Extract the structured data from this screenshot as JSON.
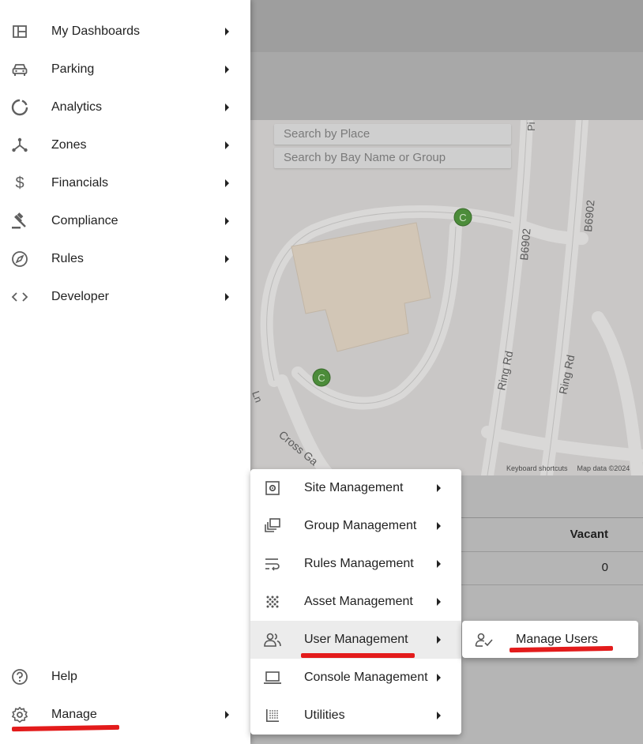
{
  "nav": {
    "items": [
      {
        "label": "My Dashboards",
        "icon": "dashboard-icon"
      },
      {
        "label": "Parking",
        "icon": "car-icon"
      },
      {
        "label": "Analytics",
        "icon": "donut-icon"
      },
      {
        "label": "Zones",
        "icon": "hub-icon"
      },
      {
        "label": "Financials",
        "icon": "dollar-icon"
      },
      {
        "label": "Compliance",
        "icon": "gavel-icon"
      },
      {
        "label": "Rules",
        "icon": "compass-icon"
      },
      {
        "label": "Developer",
        "icon": "code-icon"
      }
    ],
    "help_label": "Help",
    "manage_label": "Manage"
  },
  "manage_menu": {
    "items": [
      {
        "label": "Site Management",
        "icon": "settings-box-icon"
      },
      {
        "label": "Group Management",
        "icon": "library-icon"
      },
      {
        "label": "Rules Management",
        "icon": "wrap-text-icon"
      },
      {
        "label": "Asset Management",
        "icon": "dots-grid-icon"
      },
      {
        "label": "User Management",
        "icon": "people-icon"
      },
      {
        "label": "Console Management",
        "icon": "laptop-icon"
      },
      {
        "label": "Utilities",
        "icon": "grid-dots-icon"
      }
    ]
  },
  "user_menu": {
    "items": [
      {
        "label": "Manage Users",
        "icon": "person-check-icon"
      }
    ]
  },
  "map": {
    "search_place_placeholder": "Search by Place",
    "search_bay_placeholder": "Search by Bay Name or Group",
    "footer_shortcuts": "Keyboard shortcuts",
    "footer_data": "Map data ©2024",
    "road_labels": [
      "B6902",
      "B6902",
      "Ring Rd",
      "Ring Rd",
      "Cross Ga",
      "Ln",
      "Pi"
    ],
    "marker_letter": "C"
  },
  "table": {
    "header_vacant": "Vacant",
    "row_vacant_value": "0"
  },
  "colors": {
    "highlight_underline": "#e31b1b",
    "marker_green": "#4c8c3a"
  }
}
